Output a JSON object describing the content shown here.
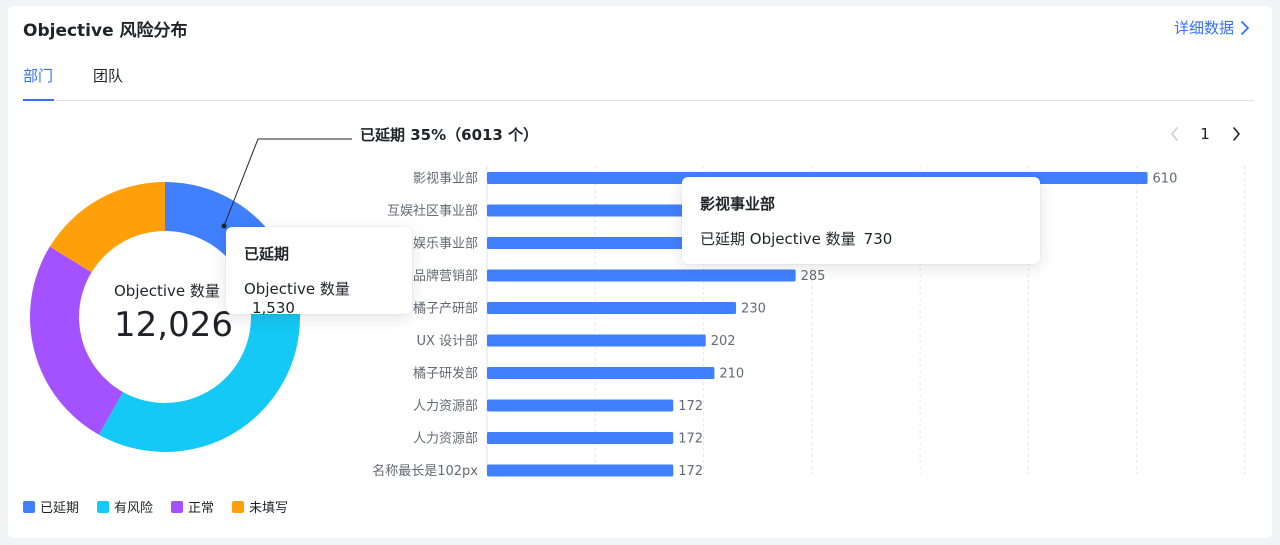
{
  "header": {
    "title": "Objective 风险分布",
    "detail_label": "详细数据"
  },
  "tabs": [
    {
      "label": "部门",
      "active": true
    },
    {
      "label": "团队",
      "active": false
    }
  ],
  "donut": {
    "center_label": "Objective 数量",
    "center_value": "12,026",
    "callout": "已延期 35%（6013 个）",
    "tooltip": {
      "title": "已延期",
      "metric": "Objective 数量",
      "value": "1,530"
    }
  },
  "bar_tooltip": {
    "title": "影视事业部",
    "metric": "已延期 Objective 数量",
    "value": "730"
  },
  "pager": {
    "page": "1"
  },
  "legend": [
    {
      "label": "已延期",
      "color": "#4080ff"
    },
    {
      "label": "有风险",
      "color": "#14c9f5"
    },
    {
      "label": "正常",
      "color": "#a451ff"
    },
    {
      "label": "未填写",
      "color": "#ffa00b"
    }
  ],
  "chart_data": [
    {
      "type": "pie",
      "categories": [
        "已延期",
        "有风险",
        "正常",
        "未填写"
      ],
      "values": [
        15,
        35,
        22,
        14
      ],
      "colors": [
        "#4080ff",
        "#14c9f5",
        "#a451ff",
        "#ffa00b"
      ],
      "note": "slice proportions are read off the visible arcs"
    },
    {
      "type": "bar",
      "orientation": "horizontal",
      "categories": [
        "影视事业部",
        "互娱社区事业部",
        "娱乐事业部",
        "品牌营销部",
        "橘子产研部",
        "UX 设计部",
        "橘子研发部",
        "人力资源部",
        "人力资源部",
        "名称最长是102px"
      ],
      "values": [
        610,
        330,
        330,
        285,
        230,
        202,
        210,
        172,
        172,
        172
      ],
      "labels": [
        "610",
        null,
        null,
        "285",
        "230",
        "202",
        "210",
        "172",
        "172",
        "172"
      ],
      "xlim": [
        0,
        700
      ],
      "color": "#4080ff",
      "grid": true
    }
  ]
}
